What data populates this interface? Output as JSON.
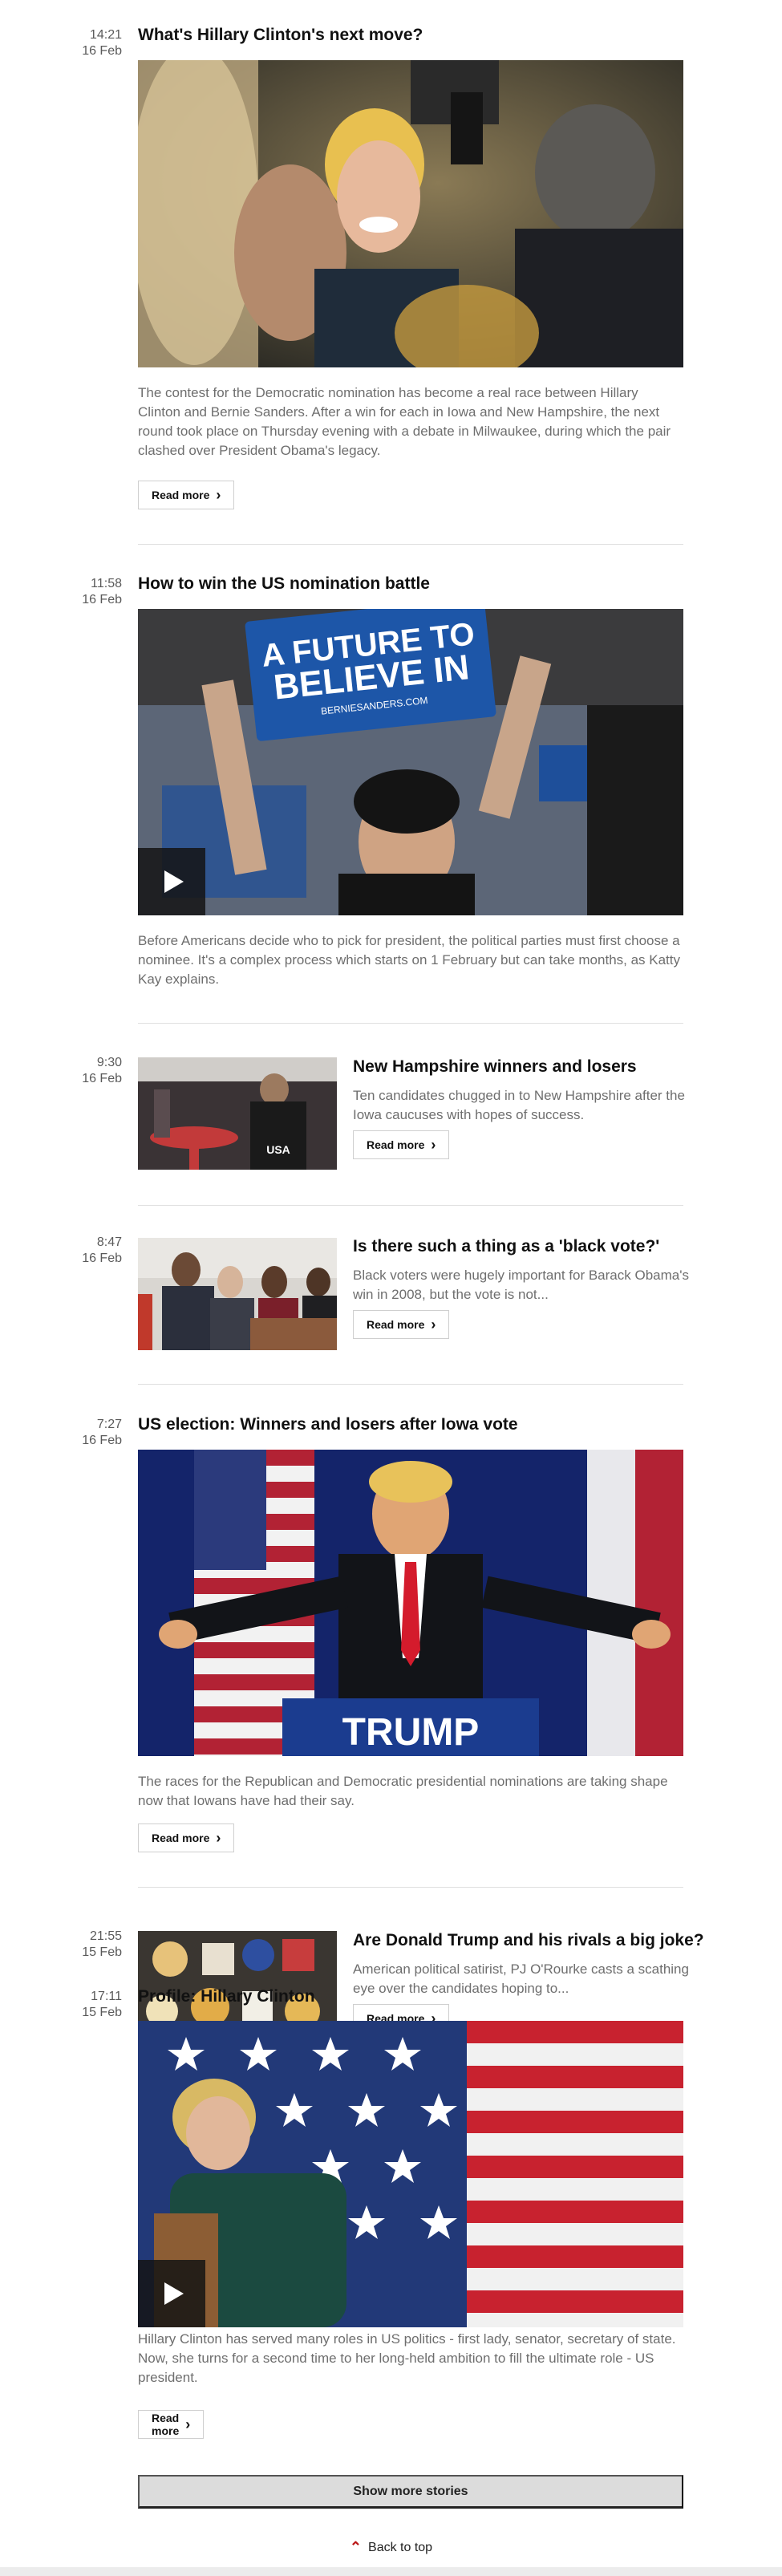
{
  "stories": [
    {
      "time": "14:21",
      "date": "16 Feb",
      "title": "What's Hillary Clinton's next move?",
      "summary": "The contest for the Democratic nomination has become a real race between Hillary Clinton and Bernie Sanders. After a win for each in Iowa and New Hampshire, the next round took place on Thursday evening with a debate in Milwaukee, during which the pair clashed over President Obama's legacy.",
      "read_more": "Read more"
    },
    {
      "time": "11:58",
      "date": "16 Feb",
      "title": "How to win the US nomination battle",
      "sign_top": "A FUTURE TO",
      "sign_bottom": "BELIEVE IN",
      "sign_url": "BERNIESANDERS.COM",
      "summary": "Before Americans decide who to pick for president, the political parties must first choose a nominee. It's a complex process which starts on 1 February but can take months, as Katty Kay explains."
    },
    {
      "time": "9:30",
      "date": "16 Feb",
      "title": "New Hampshire winners and losers",
      "jacket_text": "USA",
      "summary": "Ten candidates chugged in to New Hampshire after the Iowa caucuses with hopes of success.",
      "read_more": "Read more"
    },
    {
      "time": "8:47",
      "date": "16 Feb",
      "title": "Is there such a thing as a 'black vote?'",
      "summary": "Black voters were hugely important for Barack Obama's win in 2008, but the vote is not...",
      "read_more": "Read more"
    },
    {
      "time": "7:27",
      "date": "16 Feb",
      "title": "US election: Winners and losers after Iowa vote",
      "podium_text": "TRUMP",
      "summary": "The races for the Republican and Democratic presidential nominations are taking shape now that Iowans have had their say.",
      "read_more": "Read more"
    },
    {
      "time": "21:55",
      "date": "15 Feb",
      "title": "Are Donald Trump and his rivals a big joke?",
      "summary": "American political satirist, PJ O'Rourke casts a scathing eye over the candidates hoping to...",
      "read_more": "Read more"
    },
    {
      "time": "17:11",
      "date": "15 Feb",
      "title": "Profile: Hillary Clinton",
      "summary": "Hillary Clinton has served many roles in US politics - first lady, senator, secretary of state. Now, she turns for a second time to her long-held ambition to fill the ultimate role - US president.",
      "read_more": "Read more"
    }
  ],
  "show_more": "Show more stories",
  "back_to_top": "Back to top",
  "icons": {
    "chevron": "chevron-right-icon",
    "play": "play-icon",
    "back_to_top": "arrow-up-icon"
  },
  "colors": {
    "accent": "#bb1919",
    "divider": "#e0e0e0",
    "button_bar": "#dcdcdc"
  }
}
